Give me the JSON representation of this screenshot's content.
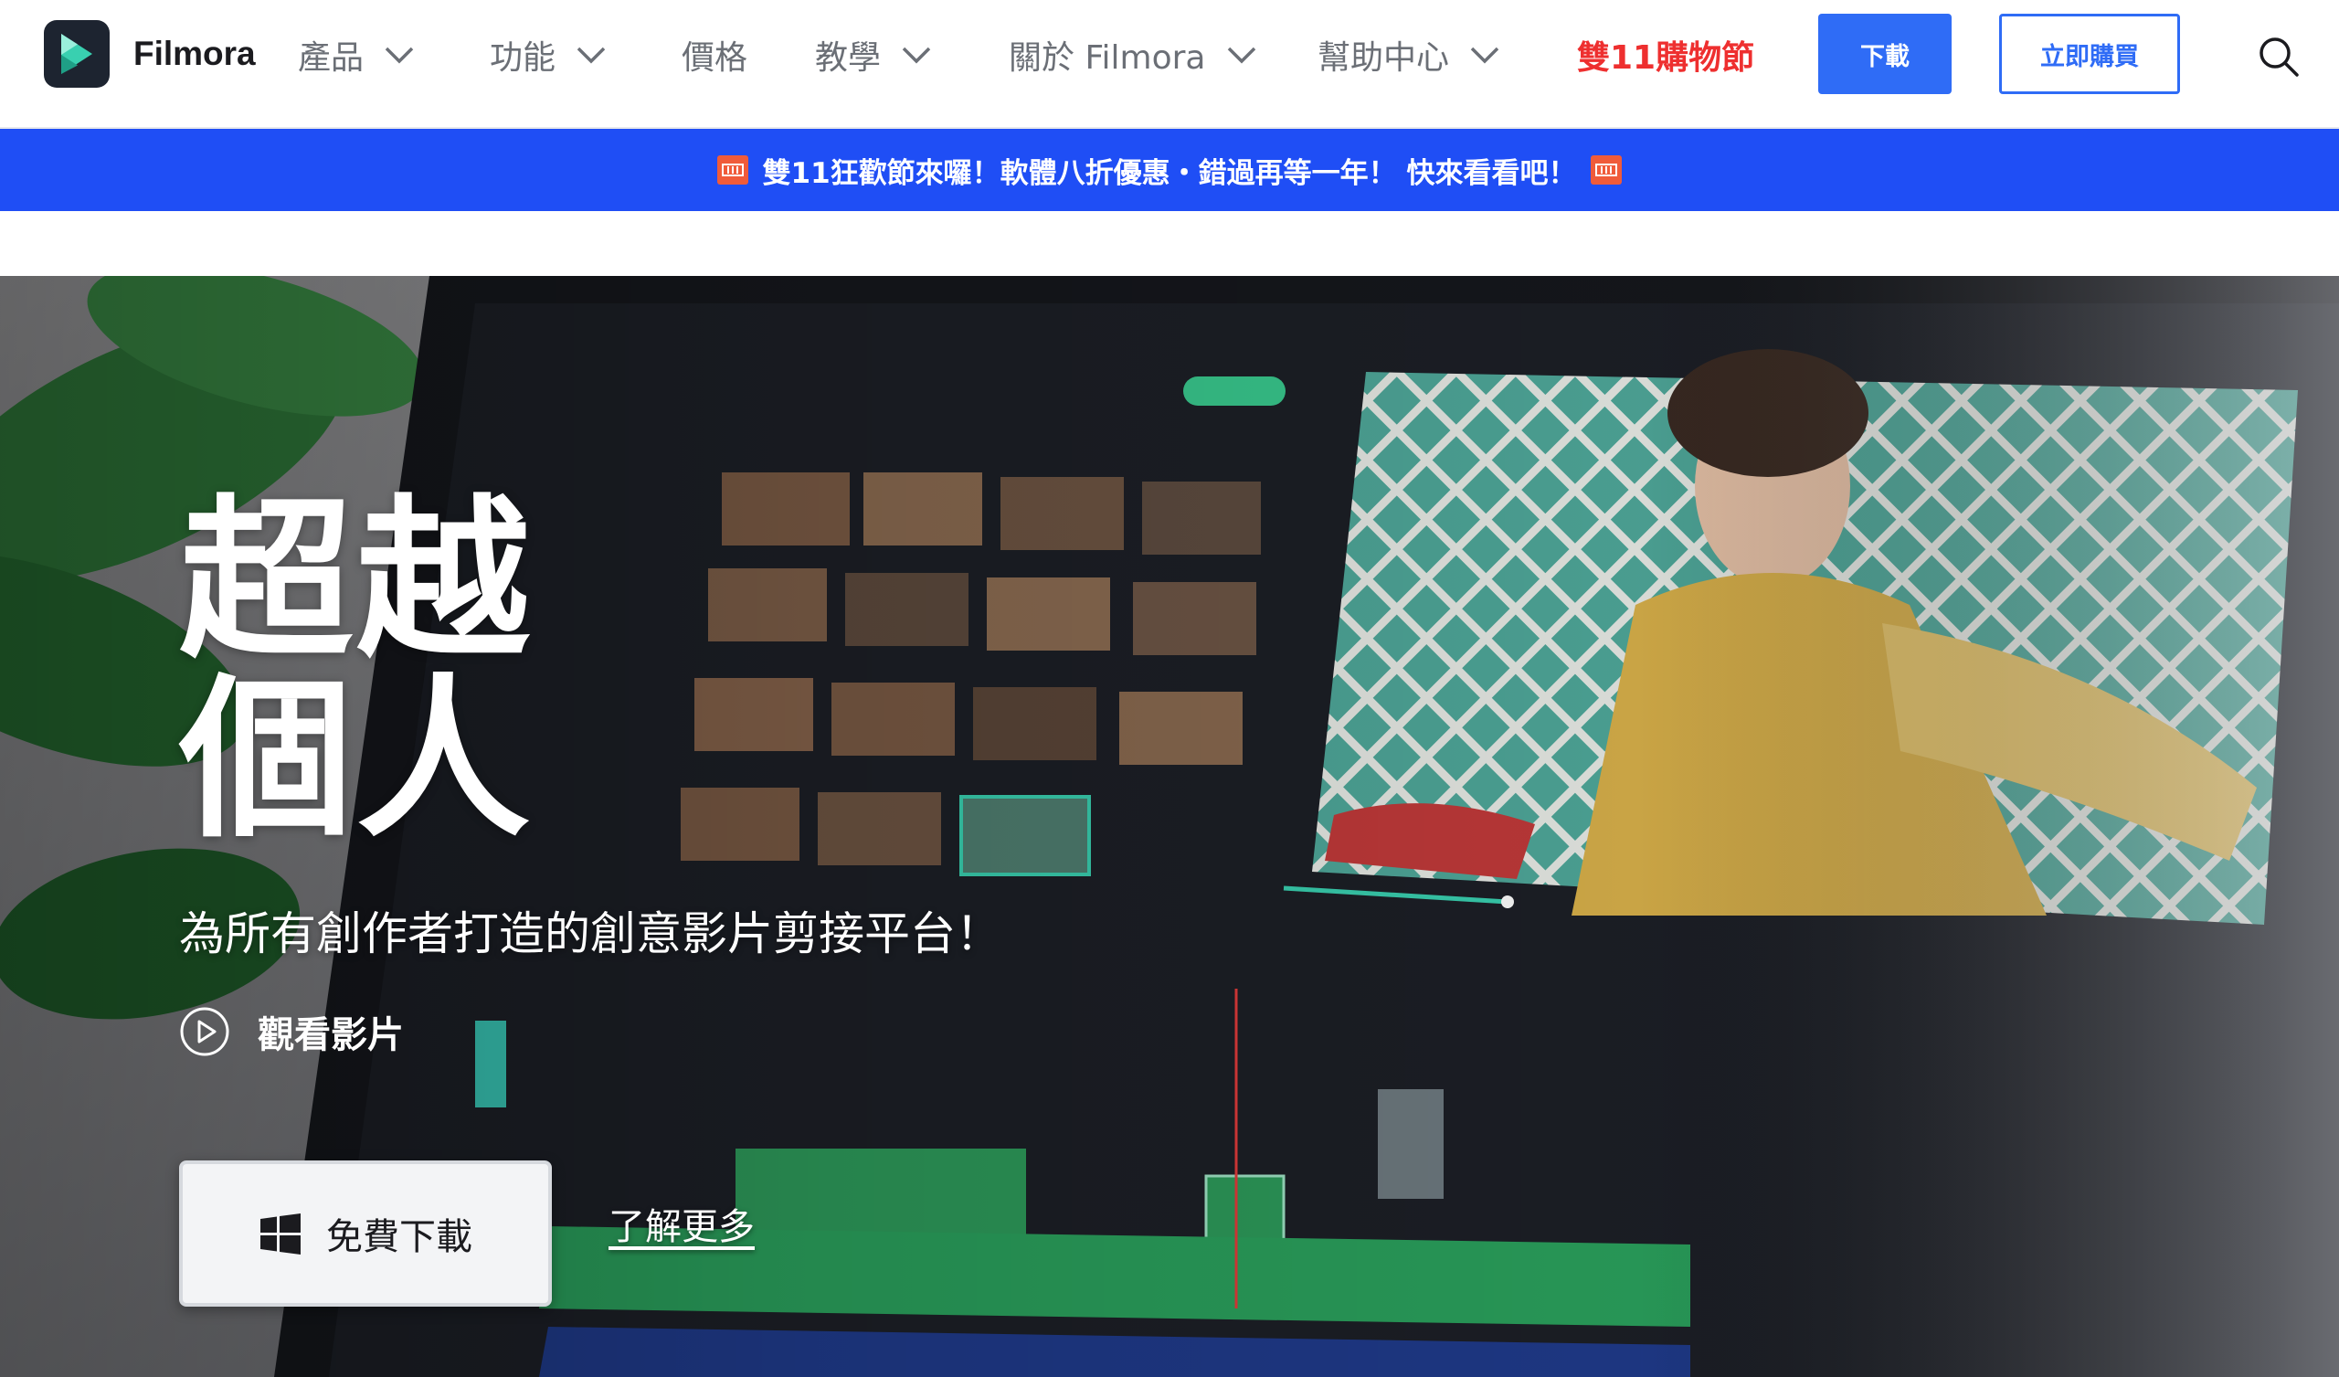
{
  "header": {
    "brand": "Filmora",
    "nav": [
      {
        "label": "產品",
        "dropdown": true
      },
      {
        "label": "功能",
        "dropdown": true
      },
      {
        "label": "價格",
        "dropdown": false
      },
      {
        "label": "教學",
        "dropdown": true
      },
      {
        "label": "關於 Filmora",
        "dropdown": true
      },
      {
        "label": "幫助中心",
        "dropdown": true
      }
    ],
    "promo_link": "雙11購物節",
    "download_label": "下載",
    "buy_label": "立即購買",
    "icons": {
      "search": "search-icon",
      "logo": "filmora-logo-icon",
      "dropdown": "chevron-down-icon"
    }
  },
  "promo_bar": {
    "text": "雙11狂歡節來囉！軟體八折優惠・錯過再等一年！ 快來看看吧！",
    "tag_icon": "coupon-icon"
  },
  "hero": {
    "title_line1": "超越",
    "title_line2": "個人",
    "subtitle": "為所有創作者打造的創意影片剪接平台！",
    "watch_label": "觀看影片",
    "free_download_label": "免費下載",
    "learn_more_label": "了解更多",
    "icons": {
      "play": "play-circle-icon",
      "windows": "windows-icon"
    }
  },
  "colors": {
    "accent": "#2f6cf6",
    "promo_bar": "#1f4ef5",
    "promo_text": "#ee2f2f",
    "nav_text": "#6b6f76",
    "logo_bg": "#1d2430",
    "logo_mark": "#39d0b0"
  }
}
